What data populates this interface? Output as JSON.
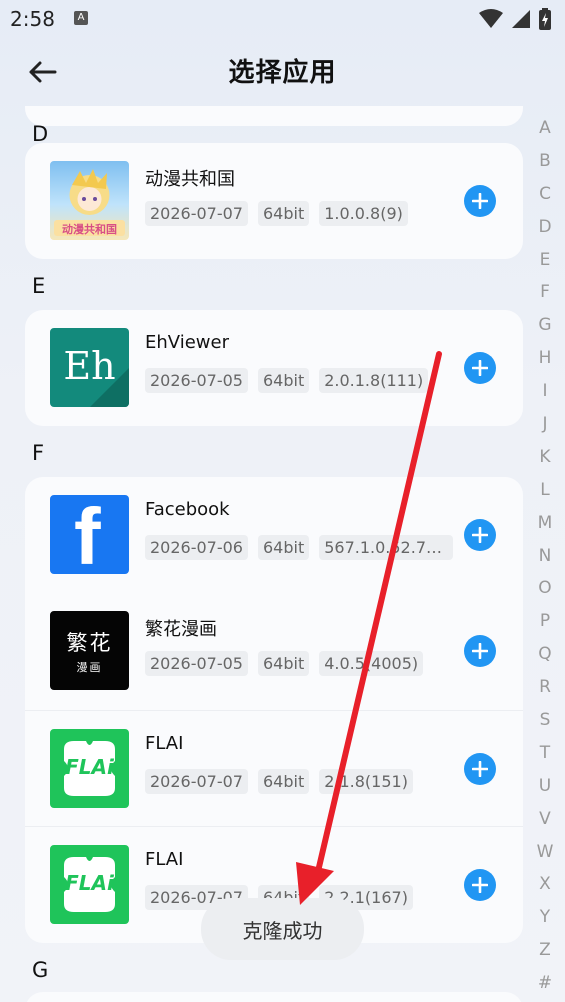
{
  "status_bar": {
    "time": "2:58",
    "notif_letter": "A"
  },
  "header": {
    "title": "选择应用"
  },
  "sections": [
    {
      "letter": "D",
      "apps": [
        {
          "name": "动漫共和国",
          "date": "2026-07-07",
          "arch": "64bit",
          "version": "1.0.0.8(9)",
          "icon_name": "dongman-app-icon",
          "icon_text": "动漫共和国"
        }
      ]
    },
    {
      "letter": "E",
      "apps": [
        {
          "name": "EhViewer",
          "date": "2026-07-05",
          "arch": "64bit",
          "version": "2.0.1.8(111)",
          "icon_name": "ehviewer-app-icon",
          "icon_text": "Eh"
        }
      ]
    },
    {
      "letter": "F",
      "apps": [
        {
          "name": "Facebook",
          "date": "2026-07-06",
          "arch": "64bit",
          "version": "567.1.0.52.74(...",
          "icon_name": "facebook-app-icon",
          "icon_text": "f"
        },
        {
          "name": "繁花漫画",
          "date": "2026-07-05",
          "arch": "64bit",
          "version": "4.0.5(4005)",
          "icon_name": "fanhua-app-icon",
          "icon_text": "繁花",
          "icon_sub": "漫画"
        },
        {
          "name": "FLAI",
          "date": "2026-07-07",
          "arch": "64bit",
          "version": "2.1.8(151)",
          "icon_name": "flai-app-icon",
          "icon_text": "FLAi"
        },
        {
          "name": "FLAI",
          "date": "2026-07-07",
          "arch": "64bit",
          "version": "2.2.1(167)",
          "icon_name": "flai-app-icon",
          "icon_text": "FLAi"
        }
      ]
    },
    {
      "letter": "G",
      "apps": []
    }
  ],
  "index_letters": [
    "A",
    "B",
    "C",
    "D",
    "E",
    "F",
    "G",
    "H",
    "I",
    "J",
    "K",
    "L",
    "M",
    "N",
    "O",
    "P",
    "Q",
    "R",
    "S",
    "T",
    "U",
    "V",
    "W",
    "X",
    "Y",
    "Z",
    "#"
  ],
  "toast": "克隆成功",
  "colors": {
    "accent": "#2196f3",
    "arrow": "#e8202a",
    "ehviewer": "#138a7c",
    "facebook": "#1877f2",
    "flai": "#1fc45a"
  }
}
